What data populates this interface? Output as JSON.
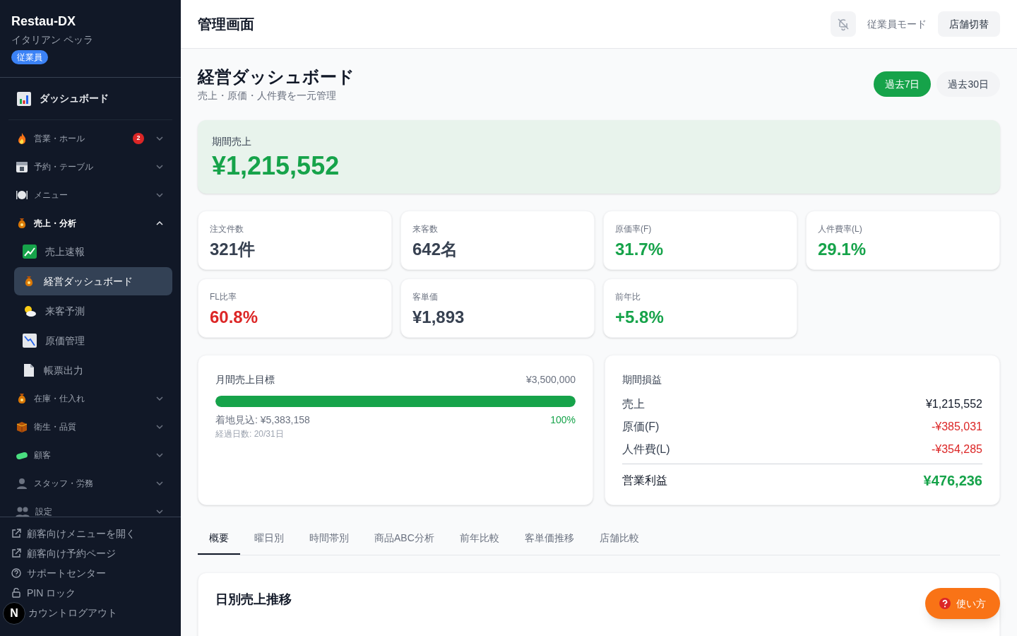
{
  "sidebar": {
    "brand": "Restau-DX",
    "store": "イタリアン ペッラ",
    "role_badge": "従業員",
    "home": {
      "label": "ダッシュボード"
    },
    "groups": [
      {
        "label": "営業・ホール",
        "badge": "2",
        "expanded": false
      },
      {
        "label": "予約・テーブル",
        "expanded": false
      },
      {
        "label": "メニュー",
        "expanded": false
      },
      {
        "label": "売上・分析",
        "expanded": true,
        "children": [
          {
            "label": "売上速報",
            "selected": false
          },
          {
            "label": "経営ダッシュボード",
            "selected": true
          },
          {
            "label": "来客予測",
            "selected": false
          },
          {
            "label": "原価管理",
            "selected": false
          },
          {
            "label": "帳票出力",
            "selected": false
          }
        ]
      },
      {
        "label": "在庫・仕入れ",
        "expanded": false
      },
      {
        "label": "衛生・品質",
        "expanded": false
      },
      {
        "label": "顧客",
        "expanded": false
      },
      {
        "label": "スタッフ・労務",
        "expanded": false
      },
      {
        "label": "設定",
        "expanded": false
      }
    ],
    "footer_links": [
      {
        "kind": "external",
        "label": "顧客向けメニューを開く"
      },
      {
        "kind": "external",
        "label": "顧客向け予約ページ"
      },
      {
        "kind": "help",
        "label": "サポートセンター"
      },
      {
        "kind": "lock",
        "label": "PIN ロック"
      },
      {
        "kind": "logout",
        "label": "カウントログアウト"
      }
    ],
    "dev_badge": "N"
  },
  "header": {
    "title": "管理画面",
    "mode": "従業員モード",
    "switch_button": "店舗切替"
  },
  "page": {
    "title": "経営ダッシュボード",
    "subtitle": "売上・原価・人件費を一元管理",
    "ranges": [
      {
        "label": "過去7日",
        "selected": true
      },
      {
        "label": "過去30日",
        "selected": false
      }
    ]
  },
  "hero": {
    "label": "期間売上",
    "value": "¥1,215,552"
  },
  "kpis": [
    {
      "label": "注文件数",
      "value": "321件",
      "color": "#374151"
    },
    {
      "label": "来客数",
      "value": "642名",
      "color": "#374151"
    },
    {
      "label": "原価率(F)",
      "value": "31.7%",
      "color": "#16a34a"
    },
    {
      "label": "人件費率(L)",
      "value": "29.1%",
      "color": "#16a34a"
    },
    {
      "label": "FL比率",
      "value": "60.8%",
      "color": "#dc2626"
    },
    {
      "label": "客単価",
      "value": "¥1,893",
      "color": "#374151"
    },
    {
      "label": "前年比",
      "value": "+5.8%",
      "color": "#16a34a"
    }
  ],
  "goal": {
    "title": "月間売上目標",
    "target": "¥3,500,000",
    "level": 1.0,
    "forecast": "着地見込: ¥5,383,158",
    "percent": "100%",
    "elapsed": "経過日数: 20/31日"
  },
  "pl": {
    "title": "期間損益",
    "rows": [
      {
        "label": "売上",
        "value": "¥1,215,552",
        "color": "#111827"
      },
      {
        "label": "原価(F)",
        "value": "-¥385,031",
        "color": "#dc2626"
      },
      {
        "label": "人件費(L)",
        "value": "-¥354,285",
        "color": "#dc2626"
      }
    ],
    "total": {
      "label": "営業利益",
      "value": "¥476,236"
    }
  },
  "tabs": [
    {
      "label": "概要",
      "selected": true
    },
    {
      "label": "曜日別",
      "selected": false
    },
    {
      "label": "時間帯別",
      "selected": false
    },
    {
      "label": "商品ABC分析",
      "selected": false
    },
    {
      "label": "前年比較",
      "selected": false
    },
    {
      "label": "客単価推移",
      "selected": false
    },
    {
      "label": "店舗比較",
      "selected": false
    }
  ],
  "chart_card": {
    "title": "日別売上推移"
  },
  "help_button": {
    "label": "使い方"
  }
}
